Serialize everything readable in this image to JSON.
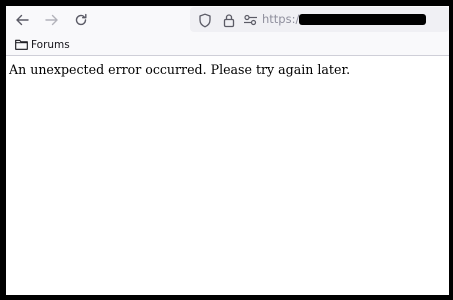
{
  "toolbar": {
    "back_icon": "arrow-left-icon",
    "forward_icon": "arrow-right-icon",
    "reload_icon": "reload-icon",
    "url": "https://"
  },
  "urlbar": {
    "icons": [
      "shield-icon",
      "lock-icon",
      "permissions-icon"
    ]
  },
  "bookmarks": {
    "items": [
      {
        "label": "Forums",
        "icon": "folder-icon"
      }
    ]
  },
  "page": {
    "message": "An unexpected error occurred. Please try again later."
  },
  "colors": {
    "chrome_bg": "#f9f9fb",
    "urlbar_bg": "#f0f0f4",
    "icon": "#5b5b66",
    "url_text": "#8f8f9d",
    "frame": "#000000"
  }
}
